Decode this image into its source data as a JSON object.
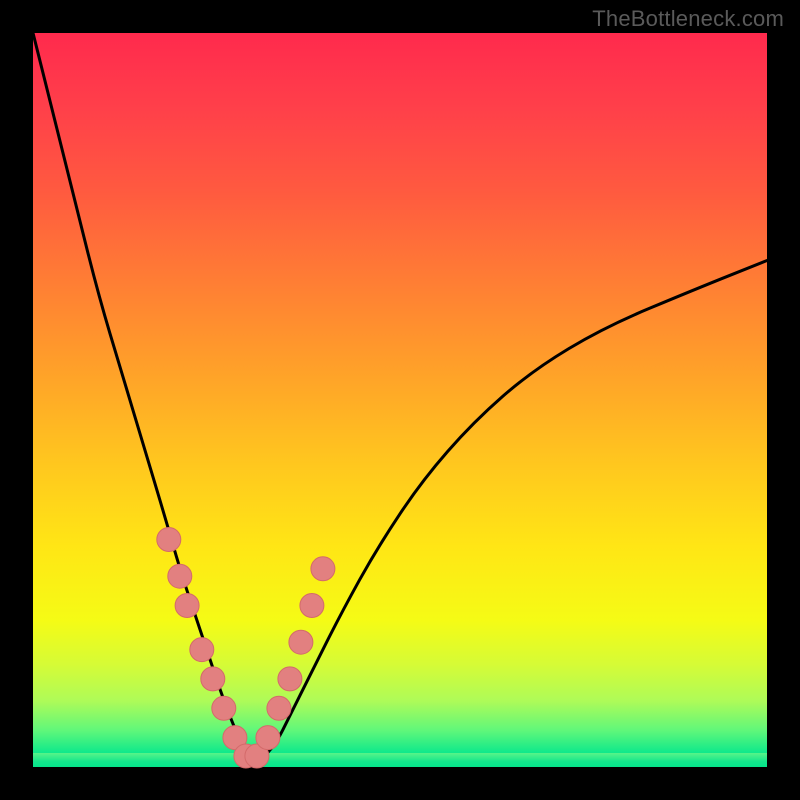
{
  "watermark": "TheBottleneck.com",
  "colors": {
    "curve": "#000000",
    "marker_fill": "#e28080",
    "marker_stroke": "#d46a6a"
  },
  "chart_data": {
    "type": "line",
    "title": "",
    "xlabel": "",
    "ylabel": "",
    "xlim": [
      0,
      100
    ],
    "ylim": [
      0,
      100
    ],
    "series": [
      {
        "name": "bottleneck-curve",
        "x": [
          0,
          3,
          6,
          9,
          12,
          15,
          18,
          20,
          22,
          24,
          26,
          28,
          29,
          30,
          31,
          33,
          35,
          38,
          42,
          47,
          53,
          60,
          68,
          78,
          90,
          100
        ],
        "y": [
          100,
          88,
          76,
          64,
          54,
          44,
          34,
          27,
          21,
          15,
          9,
          4,
          2,
          1,
          1,
          3,
          7,
          13,
          21,
          30,
          39,
          47,
          54,
          60,
          65,
          69
        ]
      }
    ],
    "markers": {
      "name": "highlighted-points",
      "x": [
        18.5,
        20,
        21,
        23,
        24.5,
        26,
        27.5,
        29,
        30.5,
        32,
        33.5,
        35,
        36.5,
        38,
        39.5
      ],
      "y": [
        31,
        26,
        22,
        16,
        12,
        8,
        4,
        1.5,
        1.5,
        4,
        8,
        12,
        17,
        22,
        27
      ]
    }
  }
}
